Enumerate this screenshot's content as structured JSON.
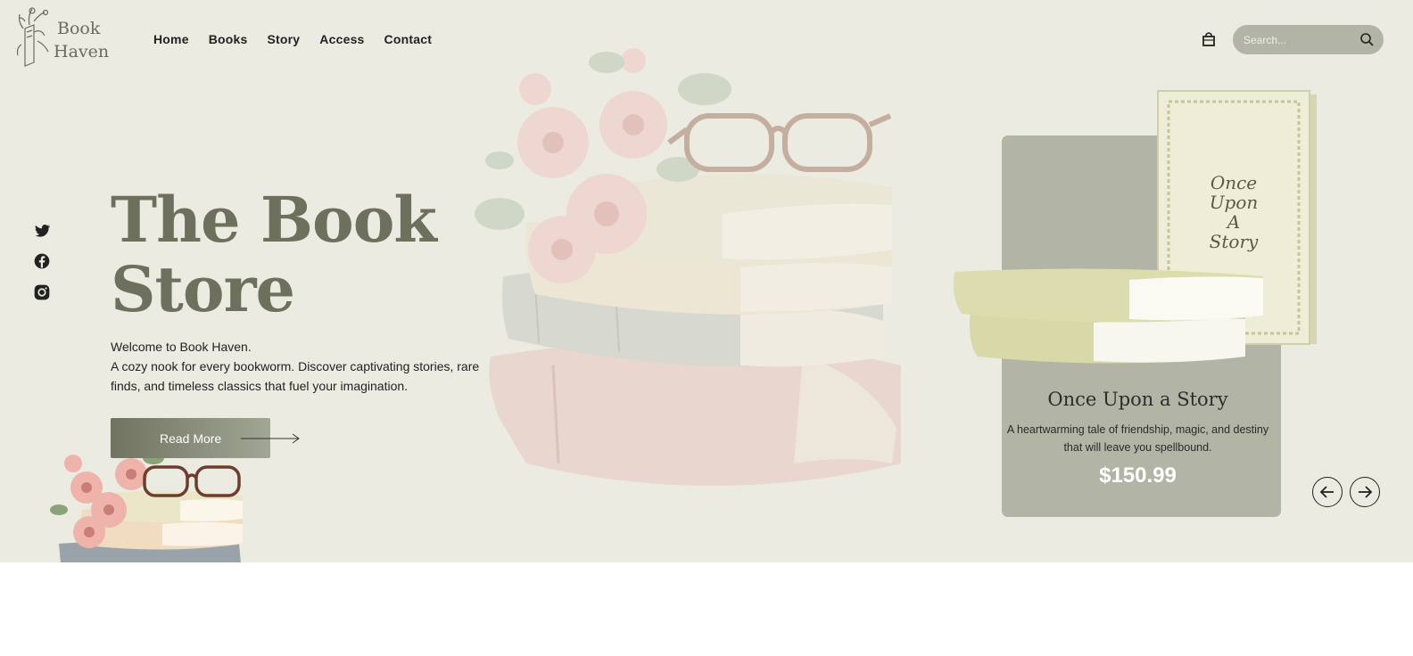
{
  "brand": {
    "logo_line1": "Book",
    "logo_line2": "Haven"
  },
  "nav": {
    "items": [
      "Home",
      "Books",
      "Story",
      "Access",
      "Contact"
    ]
  },
  "header": {
    "search_placeholder": "Search...",
    "cart_icon": "shopping-bag-icon",
    "search_icon": "magnifier-icon"
  },
  "social": {
    "icons": [
      "twitter-icon",
      "facebook-icon",
      "instagram-icon"
    ]
  },
  "hero": {
    "title_line1": "The Book",
    "title_line2": "Store",
    "welcome_line1": "Welcome to Book Haven.",
    "welcome_line2": "A cozy nook for every bookworm. Discover captivating stories, rare finds, and timeless classics that fuel your imagination.",
    "cta_label": "Read More"
  },
  "featured": {
    "book_cover_title": "Once Upon A Story",
    "title": "Once Upon a Story",
    "description": "A heartwarming tale of friendship, magic, and destiny that will leave you spellbound.",
    "price": "$150.99"
  },
  "colors": {
    "hero_bg": "#ebebe2",
    "card_bg": "#b2b5a6",
    "title": "#6d705c",
    "button_start": "#6f7360",
    "button_end": "#a2a694"
  }
}
